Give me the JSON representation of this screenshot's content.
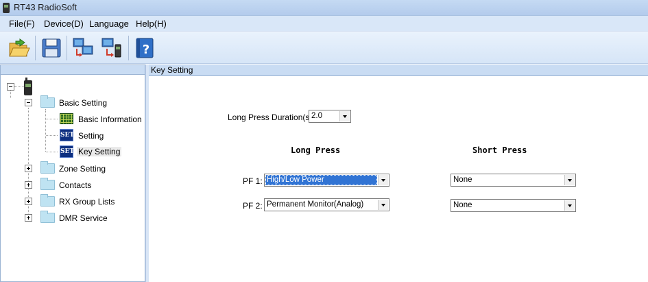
{
  "window": {
    "title": "RT43 RadioSoft"
  },
  "menu": {
    "file": "File(F)",
    "device": "Device(D)",
    "language": "Language",
    "help": "Help(H)"
  },
  "toolbar": {
    "buttons": [
      {
        "name": "open-folder-icon"
      },
      {
        "name": "save-disk-icon"
      },
      {
        "name": "read-from-radio-icon"
      },
      {
        "name": "write-to-radio-icon"
      },
      {
        "name": "help-icon"
      }
    ]
  },
  "tree": {
    "root_icon": "radio-icon",
    "basic_setting": "Basic Setting",
    "basic_information": "Basic Information",
    "setting": "Setting",
    "key_setting": "Key Setting",
    "zone_setting": "Zone Setting",
    "contacts": "Contacts",
    "rx_group_lists": "RX Group Lists",
    "dmr_service": "DMR Service",
    "set_icon_text": "SET"
  },
  "content": {
    "header": "Key Setting",
    "long_press_duration_label": "Long Press Duration(s):",
    "long_press_duration_value": "2.0",
    "long_press_heading": "Long Press",
    "short_press_heading": "Short Press",
    "pf1_label": "PF 1:",
    "pf2_label": "PF 2:",
    "pf1_long": "High/Low Power",
    "pf1_short": "None",
    "pf2_long": "Permanent Monitor(Analog)",
    "pf2_short": "None"
  },
  "colors": {
    "selection": "#3174d4",
    "header_bg": "#c9dcf3",
    "menu_bg": "#d9e7f8"
  }
}
